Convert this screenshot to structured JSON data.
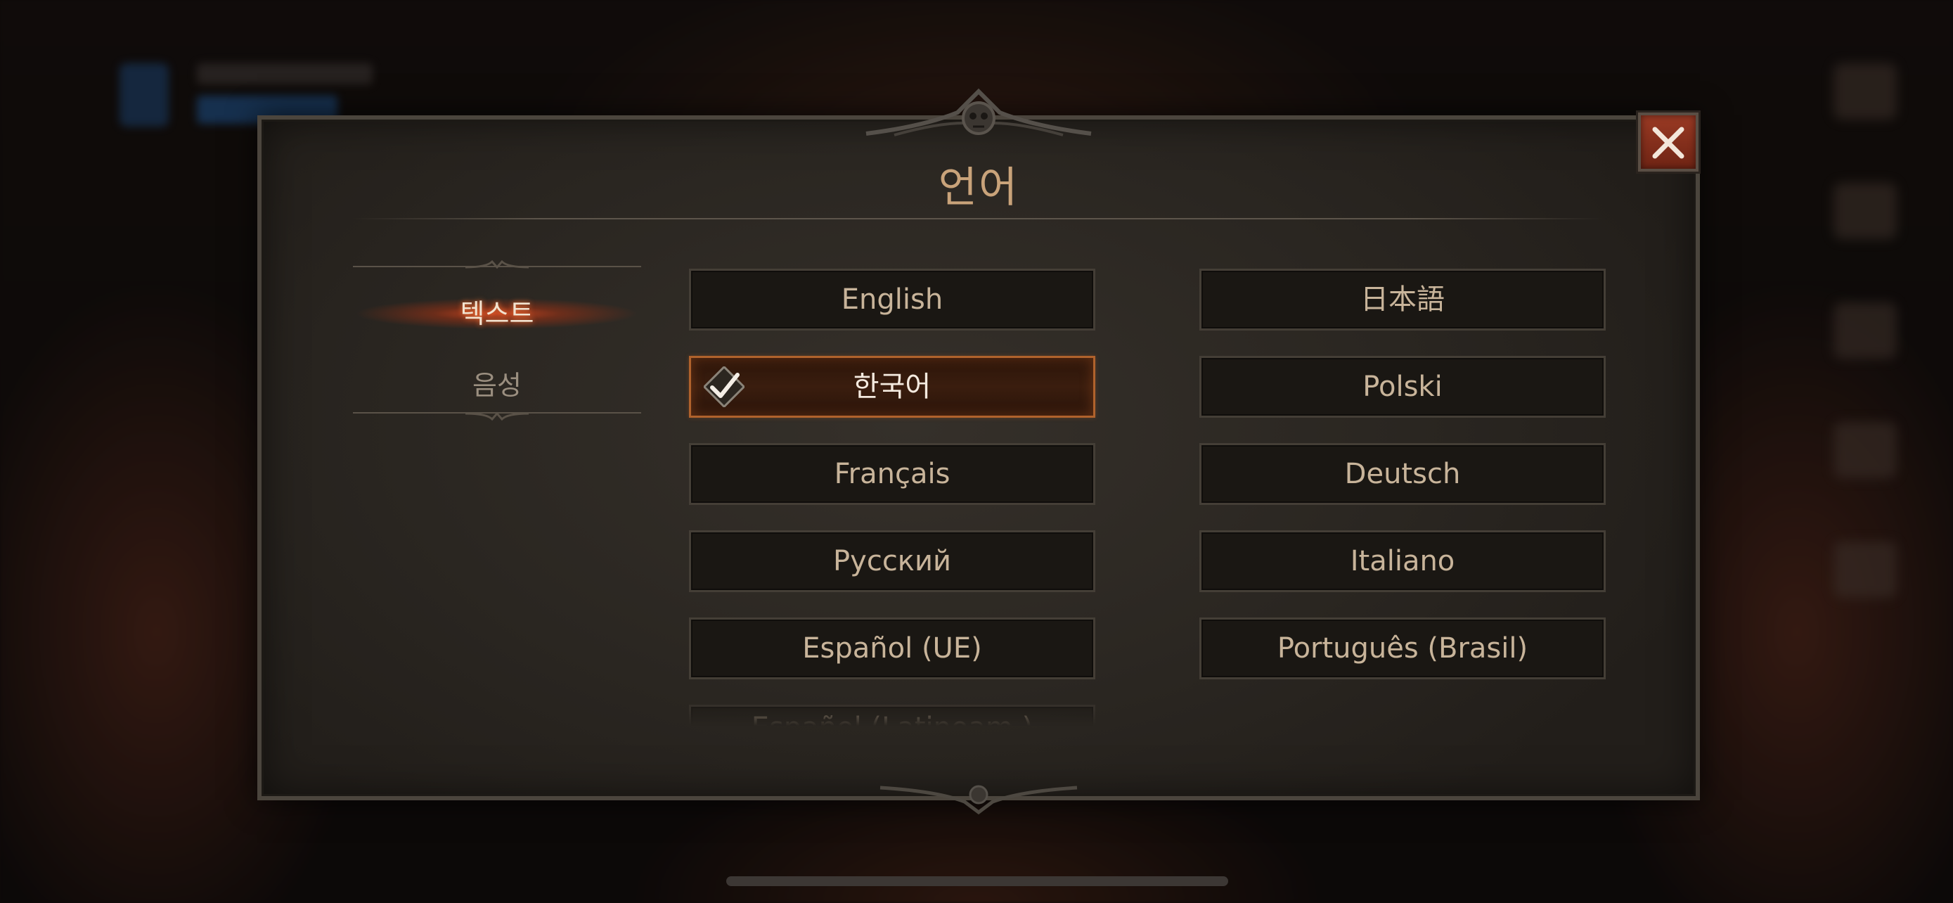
{
  "dialog": {
    "title": "언어"
  },
  "menu": {
    "items": [
      {
        "label": "텍스트",
        "active": true
      },
      {
        "label": "음성",
        "active": false
      }
    ]
  },
  "languages": {
    "left": [
      {
        "label": "English",
        "selected": false
      },
      {
        "label": "한국어",
        "selected": true
      },
      {
        "label": "Français",
        "selected": false
      },
      {
        "label": "Русский",
        "selected": false
      },
      {
        "label": "Español (UE)",
        "selected": false
      }
    ],
    "right": [
      {
        "label": "日本語",
        "selected": false
      },
      {
        "label": "Polski",
        "selected": false
      },
      {
        "label": "Deutsch",
        "selected": false
      },
      {
        "label": "Italiano",
        "selected": false
      },
      {
        "label": "Português (Brasil)",
        "selected": false
      }
    ],
    "partial_label": "Español (Latinoam.)"
  },
  "icons": {
    "close": "close-icon",
    "check": "check-icon"
  },
  "colors": {
    "accent": "#b0622c",
    "title": "#c9a37a",
    "close_button": "#8a3220"
  }
}
